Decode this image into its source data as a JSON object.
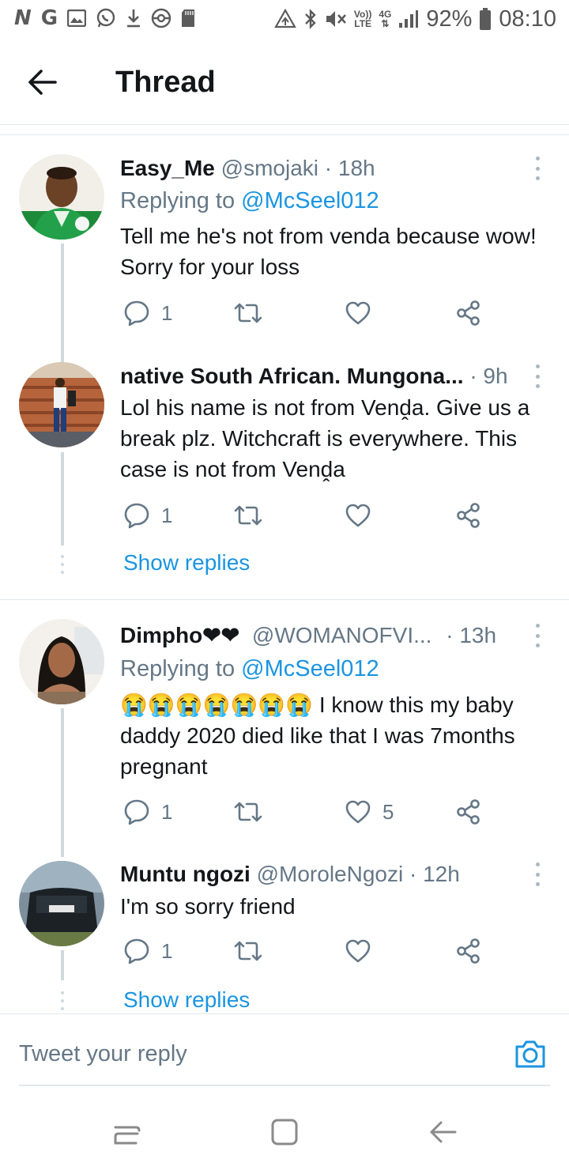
{
  "status_bar": {
    "left_letters": [
      "N",
      "G"
    ],
    "volte": "Vo))",
    "lte": "LTE",
    "network": "4G",
    "battery": "92%",
    "time": "08:10"
  },
  "header": {
    "title": "Thread"
  },
  "tweets": [
    {
      "display_name": "Easy_Me",
      "handle": "@smojaki",
      "time": "· 18h",
      "replying_prefix": "Replying to",
      "replying_handle": "@McSeel012",
      "text": "Tell me he's not from venda because wow! Sorry for your loss",
      "reply_count": "1",
      "like_count": ""
    },
    {
      "display_name": "native South African. Mungona...",
      "handle": "",
      "time": "· 9h",
      "text": "Lol his name is not from Venḓa. Give us a break plz. Witchcraft is everywhere. This case is not from Venḓa",
      "reply_count": "1",
      "like_count": "",
      "show_replies": "Show replies"
    },
    {
      "display_name": "Dimpho❤❤",
      "handle": "@WOMANOFVI...",
      "time": "· 13h",
      "replying_prefix": "Replying to",
      "replying_handle": "@McSeel012",
      "emojis": "😭😭😭😭😭😭😭",
      "text": " I know this my baby daddy 2020 died like that  I was 7months pregnant",
      "reply_count": "1",
      "like_count": "5"
    },
    {
      "display_name": "Muntu ngozi",
      "handle": "@MoroleNgozi",
      "time": "· 12h",
      "text": "I'm so sorry friend",
      "reply_count": "1",
      "like_count": "",
      "show_replies": "Show replies"
    }
  ],
  "reply_bar": {
    "placeholder": "Tweet your reply"
  },
  "colors": {
    "accent": "#1b95e0",
    "muted": "#657786",
    "text": "#14171a",
    "divider": "#e1e8ed"
  }
}
